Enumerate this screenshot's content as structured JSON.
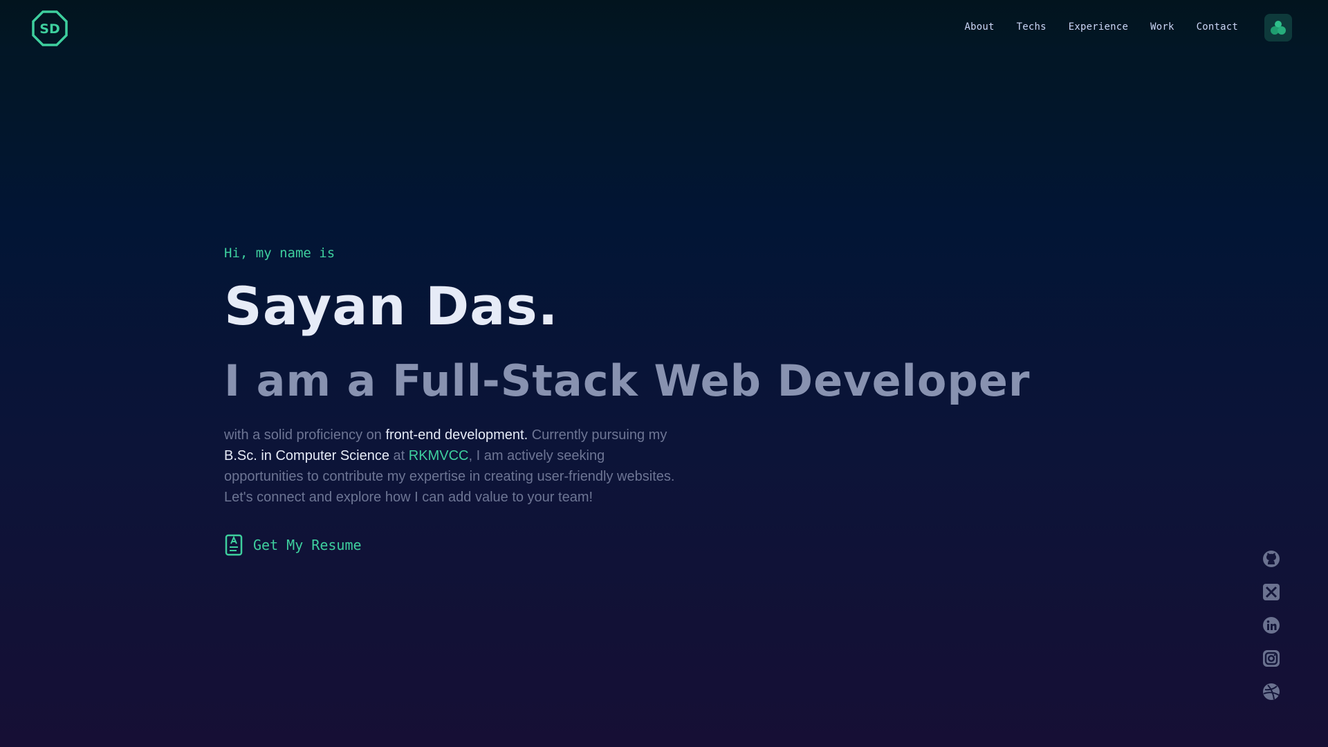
{
  "brand": {
    "logo_text": "SD",
    "accent_color": "#3ecf9e"
  },
  "nav": {
    "items": [
      {
        "label": "About"
      },
      {
        "label": "Techs"
      },
      {
        "label": "Experience"
      },
      {
        "label": "Work"
      },
      {
        "label": "Contact"
      }
    ],
    "theme_icon": "user-theme-icon"
  },
  "hero": {
    "greeting": "Hi, my name is",
    "name": "Sayan Das.",
    "role": "I am a Full-Stack Web Developer",
    "bio": {
      "p1": "with a solid proficiency on ",
      "h1": "front-end development.",
      "p2": " Currently pursuing my ",
      "h2": "B.Sc. in Computer Science",
      "p3": " at ",
      "a1": "RKMVCC",
      "p4": ", I am actively seeking opportunities to contribute my expertise in creating user-friendly websites. Let's connect and explore how I can add value to your team!"
    },
    "resume_label": "Get My Resume",
    "resume_icon": "resume-icon"
  },
  "socials": [
    {
      "icon": "github-icon"
    },
    {
      "icon": "x-twitter-icon"
    },
    {
      "icon": "linkedin-icon"
    },
    {
      "icon": "instagram-icon"
    },
    {
      "icon": "dribbble-icon"
    }
  ],
  "colors": {
    "accent": "#3ecf9e",
    "heading": "#e6ebf7",
    "muted": "#8892b0",
    "body": "#6d7594"
  }
}
